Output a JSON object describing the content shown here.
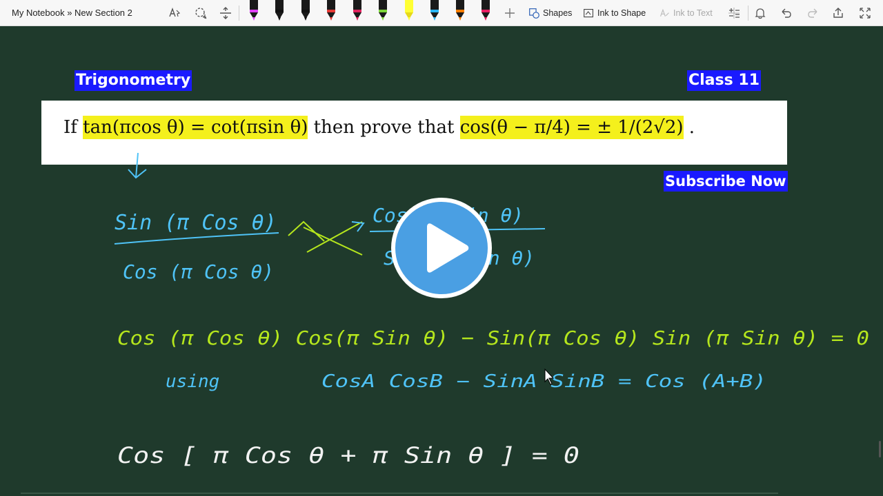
{
  "toolbar": {
    "breadcrumb": "My Notebook » New Section 2",
    "shapes_label": "Shapes",
    "ink_to_shape_label": "Ink to Shape",
    "ink_to_text_label": "Ink to Text",
    "pens": [
      {
        "color": "#e040fb",
        "name": "pen-pink"
      },
      {
        "color": "#111111",
        "name": "pen-black-1"
      },
      {
        "color": "#111111",
        "name": "pen-black-2"
      },
      {
        "color": "#e53935",
        "name": "pen-red"
      },
      {
        "color": "#e0245e",
        "name": "pen-magenta"
      },
      {
        "color": "#7cd639",
        "name": "pen-green"
      },
      {
        "color": "#ffff33",
        "name": "highlighter-yellow"
      },
      {
        "color": "#29b6f6",
        "name": "pen-blue"
      },
      {
        "color": "#f57c00",
        "name": "pen-orange"
      },
      {
        "color": "#e91e63",
        "name": "pen-rose"
      }
    ]
  },
  "canvas": {
    "tag_left": "Trigonometry",
    "tag_right": "Class 11",
    "subscribe": "Subscribe Now",
    "problem": {
      "part1": "If ",
      "part2": "tan(πcos θ) = cot(πsin θ)",
      "part3": " then prove that ",
      "part4": "cos(θ − π/4) = ± 1/(2√2)",
      "part5": " ."
    },
    "ink": {
      "line1_num": "Sin (π Cos θ)",
      "line1_den": "Cos (π Cos θ)",
      "line1_rhs_num": "Cos (π Sin θ)",
      "line1_rhs_den": "Sin (π Sin θ)",
      "line2": "Cos (π Cos θ) Cos(π Sin θ) − Sin(π Cos θ) Sin (π Sin θ) = 0",
      "line3_a": "using",
      "line3_b": "CosA CosB − SinA SinB =  Cos (A+B)",
      "line4": "Cos [ π Cos θ  +  π Sin θ ]    = 0"
    }
  },
  "colors": {
    "board": "#1f3a2c",
    "ink_blue": "#4fc3f7",
    "ink_green": "#b5e61d",
    "ink_white": "#f2f2f2",
    "tag_bg": "#1a1aff",
    "play_blue": "#4a9fe3"
  }
}
